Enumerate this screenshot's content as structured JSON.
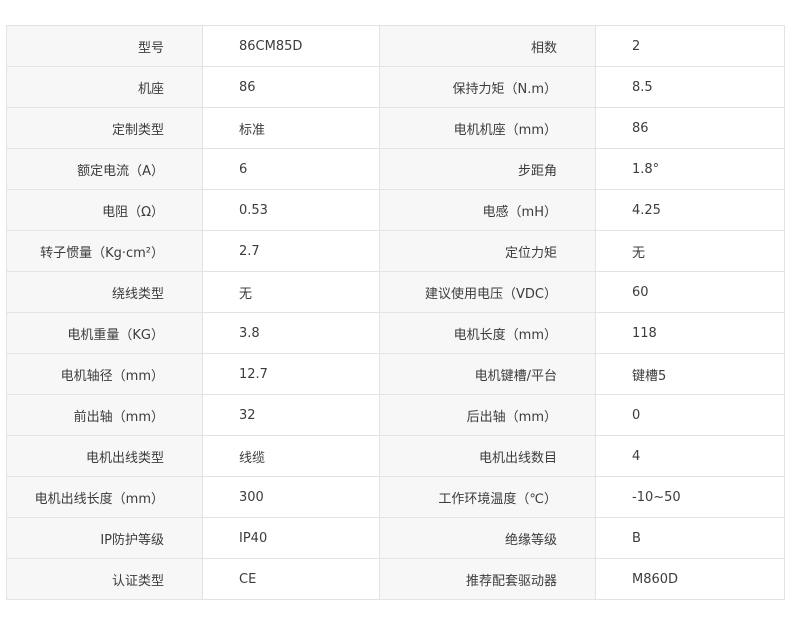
{
  "spec_rows": [
    {
      "left_label": "型号",
      "left_value": "86CM85D",
      "right_label": "相数",
      "right_value": "2"
    },
    {
      "left_label": "机座",
      "left_value": "86",
      "right_label": "保持力矩（N.m）",
      "right_value": "8.5"
    },
    {
      "left_label": "定制类型",
      "left_value": "标准",
      "right_label": "电机机座（mm）",
      "right_value": "86"
    },
    {
      "left_label": "额定电流（A）",
      "left_value": "6",
      "right_label": "步距角",
      "right_value": "1.8°"
    },
    {
      "left_label": "电阻（Ω）",
      "left_value": "0.53",
      "right_label": "电感（mH）",
      "right_value": "4.25"
    },
    {
      "left_label": "转子惯量（Kg·cm²）",
      "left_value": "2.7",
      "right_label": "定位力矩",
      "right_value": "无"
    },
    {
      "left_label": "绕线类型",
      "left_value": "无",
      "right_label": "建议使用电压（VDC）",
      "right_value": "60"
    },
    {
      "left_label": "电机重量（KG）",
      "left_value": "3.8",
      "right_label": "电机长度（mm）",
      "right_value": "118"
    },
    {
      "left_label": "电机轴径（mm）",
      "left_value": "12.7",
      "right_label": "电机键槽/平台",
      "right_value": "键槽5"
    },
    {
      "left_label": "前出轴（mm）",
      "left_value": "32",
      "right_label": "后出轴（mm）",
      "right_value": "0"
    },
    {
      "left_label": "电机出线类型",
      "left_value": "线缆",
      "right_label": "电机出线数目",
      "right_value": "4"
    },
    {
      "left_label": "电机出线长度（mm）",
      "left_value": "300",
      "right_label": "工作环境温度（℃）",
      "right_value": "-10~50"
    },
    {
      "left_label": "IP防护等级",
      "left_value": "IP40",
      "right_label": "绝缘等级",
      "right_value": "B"
    },
    {
      "left_label": "认证类型",
      "left_value": "CE",
      "right_label": "推荐配套驱动器",
      "right_value": "M860D"
    }
  ]
}
